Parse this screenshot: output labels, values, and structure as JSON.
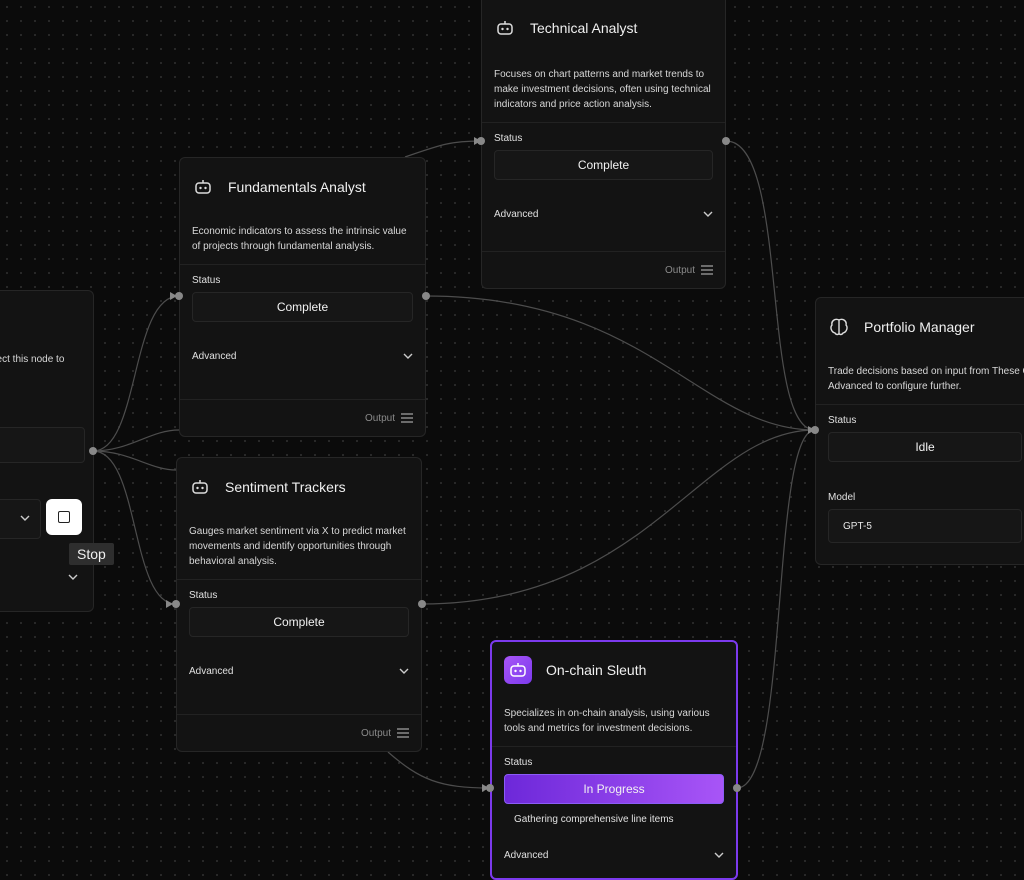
{
  "left_node": {
    "desc_fragment": "nect this node to",
    "stop_tooltip": "Stop"
  },
  "nodes": {
    "technical": {
      "title": "Technical Analyst",
      "description": "Focuses on chart patterns and market trends to make investment decisions, often using technical indicators and price action analysis.",
      "status_label": "Status",
      "status": "Complete",
      "advanced": "Advanced",
      "output": "Output",
      "icon": "robot-icon"
    },
    "fundamentals": {
      "title": "Fundamentals Analyst",
      "description": "Economic indicators to assess the intrinsic value of projects through fundamental analysis.",
      "status_label": "Status",
      "status": "Complete",
      "advanced": "Advanced",
      "output": "Output",
      "icon": "robot-icon"
    },
    "sentiment": {
      "title": "Sentiment Trackers",
      "description": "Gauges market sentiment via X to predict market movements and identify opportunities through behavioral analysis.",
      "status_label": "Status",
      "status": "Complete",
      "advanced": "Advanced",
      "output": "Output",
      "icon": "robot-icon"
    },
    "portfolio": {
      "title": "Portfolio Manager",
      "description": "Trade decisions based on input from These Click Advanced to configure further.",
      "status_label": "Status",
      "status": "Idle",
      "model_label": "Model",
      "model": "GPT-5",
      "icon": "brain-icon"
    },
    "onchain": {
      "title": "On-chain Sleuth",
      "description": "Specializes in on-chain analysis, using various tools and metrics for investment decisions.",
      "status_label": "Status",
      "status": "In Progress",
      "progress_text": "Gathering comprehensive line items",
      "advanced": "Advanced",
      "icon": "robot-icon"
    }
  },
  "colors": {
    "background": "#0b0b0b",
    "node": "#131313",
    "accent": "#7c3aed",
    "edge": "#555555"
  }
}
